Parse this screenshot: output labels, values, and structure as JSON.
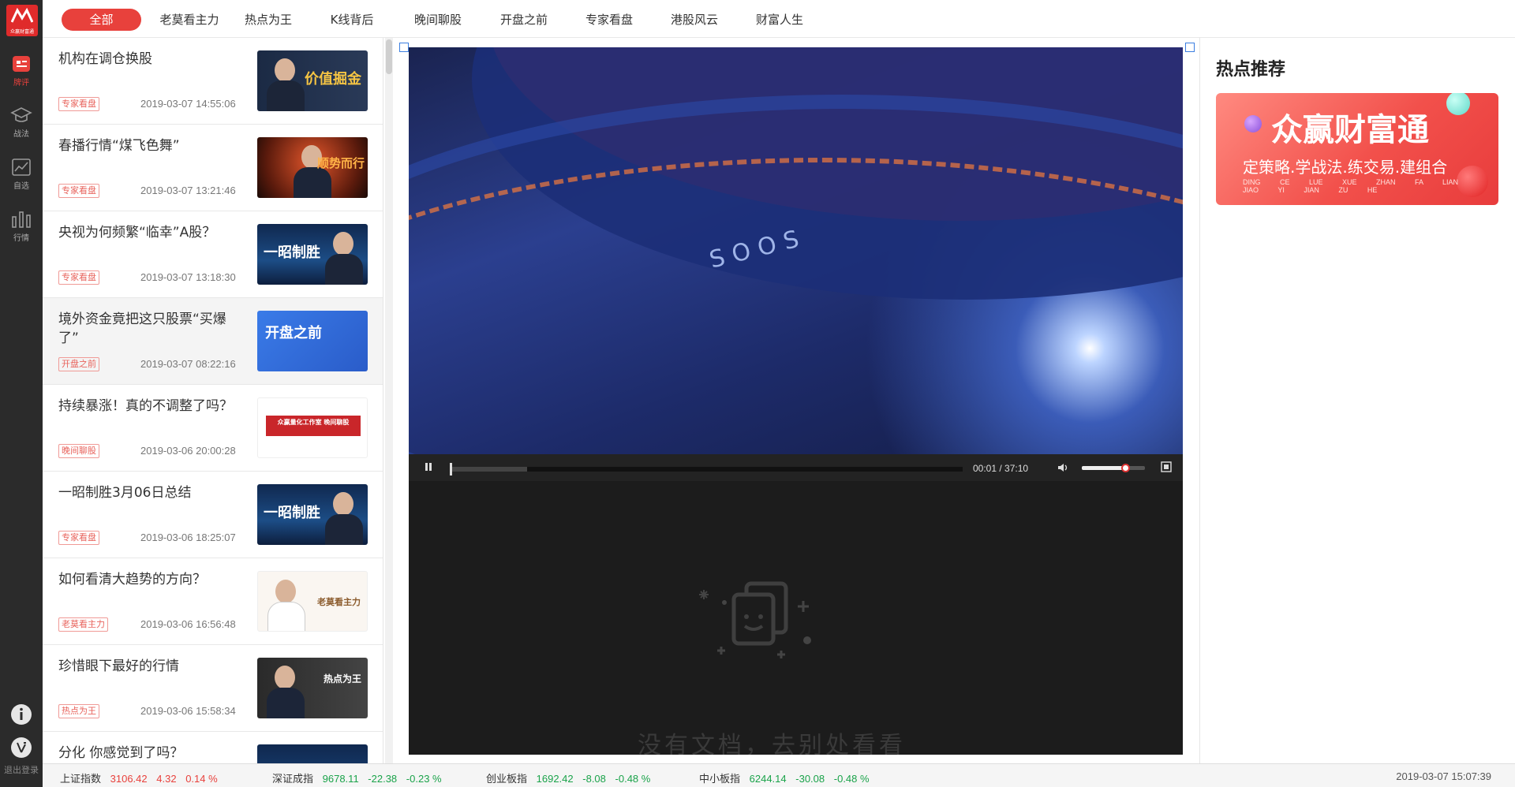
{
  "app": {
    "logo_text": "众赢财富通",
    "rail": [
      {
        "label": "牌评",
        "icon": "news-icon",
        "active": true
      },
      {
        "label": "战法",
        "icon": "graduation-cap-icon",
        "active": false
      },
      {
        "label": "自选",
        "icon": "trend-chart-icon",
        "active": false
      },
      {
        "label": "行情",
        "icon": "bar-chart-icon",
        "active": false
      }
    ],
    "logout_label": "退出登录"
  },
  "tabs": [
    "全部",
    "老莫看主力",
    "热点为王",
    "K线背后",
    "晚间聊股",
    "开盘之前",
    "专家看盘",
    "港股风云",
    "财富人生"
  ],
  "list": [
    {
      "title": "机构在调仓换股",
      "tag": "专家看盘",
      "time": "2019-03-07 14:55:06",
      "thumb_text": "价值掘金"
    },
    {
      "title": "春播行情“煤飞色舞”",
      "tag": "专家看盘",
      "time": "2019-03-07 13:21:46",
      "thumb_text": "顺势而行"
    },
    {
      "title": "央视为何频繁“临幸”A股？",
      "tag": "专家看盘",
      "time": "2019-03-07 13:18:30",
      "thumb_text": "一昭制胜"
    },
    {
      "title": "境外资金竟把这只股票“买爆了”",
      "tag": "开盘之前",
      "time": "2019-03-07 08:22:16",
      "thumb_text": "开盘之前"
    },
    {
      "title": "持续暴涨！真的不调整了吗？",
      "tag": "晚间聊股",
      "time": "2019-03-06 20:00:28",
      "thumb_text": "众赢量化工作室 晚间聊股"
    },
    {
      "title": "一昭制胜3月06日总结",
      "tag": "专家看盘",
      "time": "2019-03-06 18:25:07",
      "thumb_text": "一昭制胜"
    },
    {
      "title": "如何看清大趋势的方向？",
      "tag": "老莫看主力",
      "time": "2019-03-06 16:56:48",
      "thumb_text": "老莫看主力"
    },
    {
      "title": "珍惜眼下最好的行情",
      "tag": "热点为王",
      "time": "2019-03-06 15:58:34",
      "thumb_text": "热点为王"
    },
    {
      "title": "分化 你感觉到了吗？",
      "tag": "",
      "time": "",
      "thumb_text": ""
    }
  ],
  "player": {
    "time": "00:01 / 37:10",
    "progress": 0.0004,
    "buffered": 0.15,
    "volume": 0.7,
    "overlay_text": "SOOS",
    "no_doc_text": "没有文档，去别处看看"
  },
  "right": {
    "heading": "热点推荐",
    "banner_title": "众赢财富通",
    "banner_sub": "定策略.学战法.练交易.建组合",
    "banner_pinyin": "DING CE LUE XUE ZHAN FA LIAN JIAO YI JIAN ZU HE"
  },
  "footer": {
    "indices": [
      {
        "name": "上证指数",
        "value": "3106.42",
        "change": "4.32",
        "pct": "0.14 %",
        "dir": "up"
      },
      {
        "name": "深证成指",
        "value": "9678.11",
        "change": "-22.38",
        "pct": "-0.23 %",
        "dir": "down"
      },
      {
        "name": "创业板指",
        "value": "1692.42",
        "change": "-8.08",
        "pct": "-0.48 %",
        "dir": "down"
      },
      {
        "name": "中小板指",
        "value": "6244.14",
        "change": "-30.08",
        "pct": "-0.48 %",
        "dir": "down"
      }
    ],
    "datetime": "2019-03-07 15:07:39"
  },
  "colors": {
    "accent": "#e8413c",
    "rail": "#2b2b2b",
    "up": "#e8413c",
    "down": "#1aa34a"
  }
}
